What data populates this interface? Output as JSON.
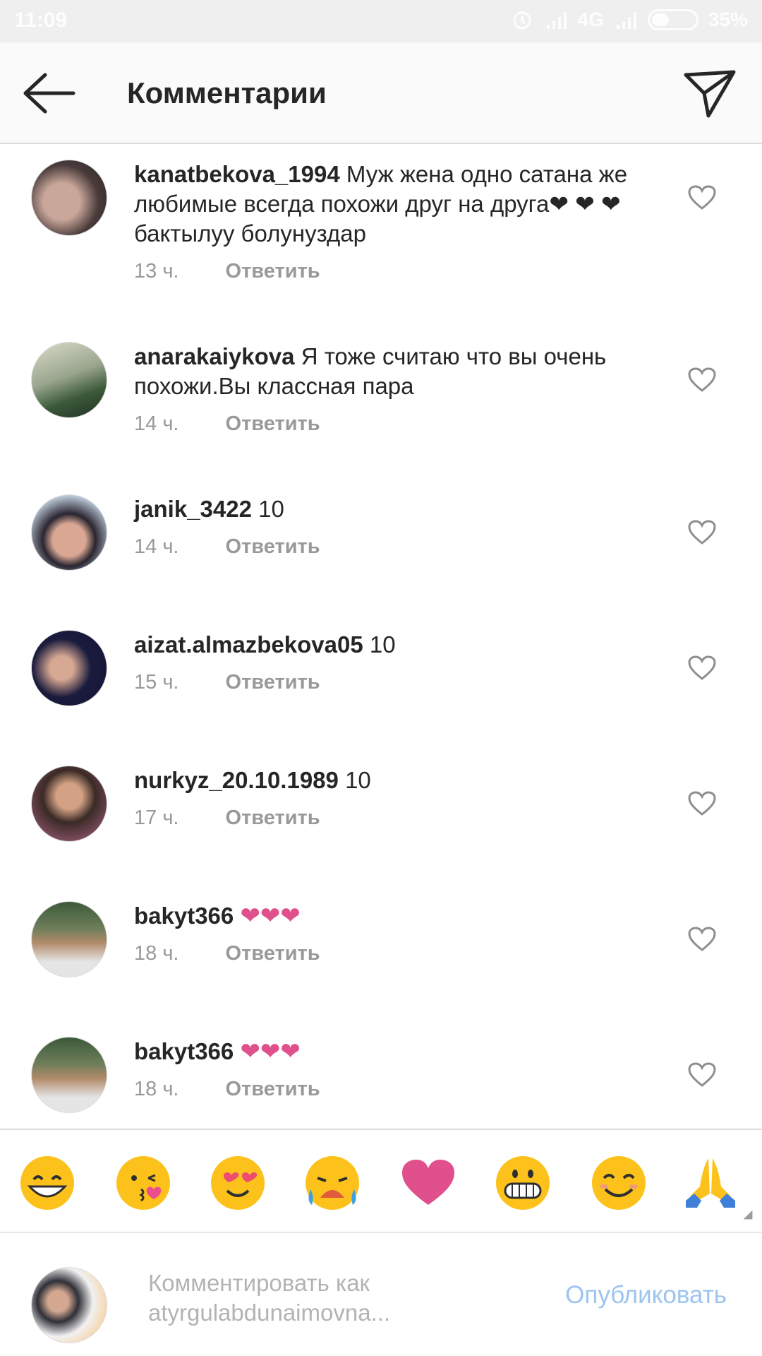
{
  "status_bar": {
    "time": "11:09",
    "network": "4G",
    "battery": "35%",
    "icons": [
      "alarm-icon",
      "signal-icon",
      "signal-icon",
      "battery-icon"
    ]
  },
  "header": {
    "title": "Комментарии",
    "back_icon": "arrow-left-icon",
    "direct_icon": "paper-plane-icon"
  },
  "comments": [
    {
      "username": "kanatbekova_1994",
      "text": "Муж жена одно сатана же любимые всегда похожи друг на друга❤ ❤ ❤  бактылуу болунуздар",
      "time": "13 ч.",
      "reply": "Ответить"
    },
    {
      "username": "anarakaiykova",
      "text": "Я тоже считаю что вы очень похожи.Вы классная пара",
      "time": "14 ч.",
      "reply": "Ответить"
    },
    {
      "username": "janik_3422",
      "text": "10",
      "time": "14 ч.",
      "reply": "Ответить"
    },
    {
      "username": "aizat.almazbekova05",
      "text": "10",
      "time": "15 ч.",
      "reply": "Ответить"
    },
    {
      "username": "nurkyz_20.10.1989",
      "text": "10",
      "time": "17 ч.",
      "reply": "Ответить"
    },
    {
      "username": "bakyt366",
      "text": "❤❤❤",
      "time": "18 ч.",
      "reply": "Ответить"
    },
    {
      "username": "bakyt366",
      "text": "❤❤❤",
      "time": "18 ч.",
      "reply": "Ответить"
    }
  ],
  "emoji_bar": [
    "grinning-face-icon",
    "kissing-face-icon",
    "heart-eyes-face-icon",
    "crying-face-icon",
    "heart-icon",
    "grimacing-face-icon",
    "smiling-face-icon",
    "praying-hands-icon"
  ],
  "composer": {
    "placeholder": "Комментировать как atyrgulabdunaimovna...",
    "placeholder_line1": "Комментировать как",
    "placeholder_line2": "atyrgulabdunaimovna...",
    "publish_label": "Опубликовать"
  },
  "colors": {
    "heart_pink": "#e0508c",
    "link_blue": "#9cc4f0",
    "meta_gray": "#999999"
  }
}
